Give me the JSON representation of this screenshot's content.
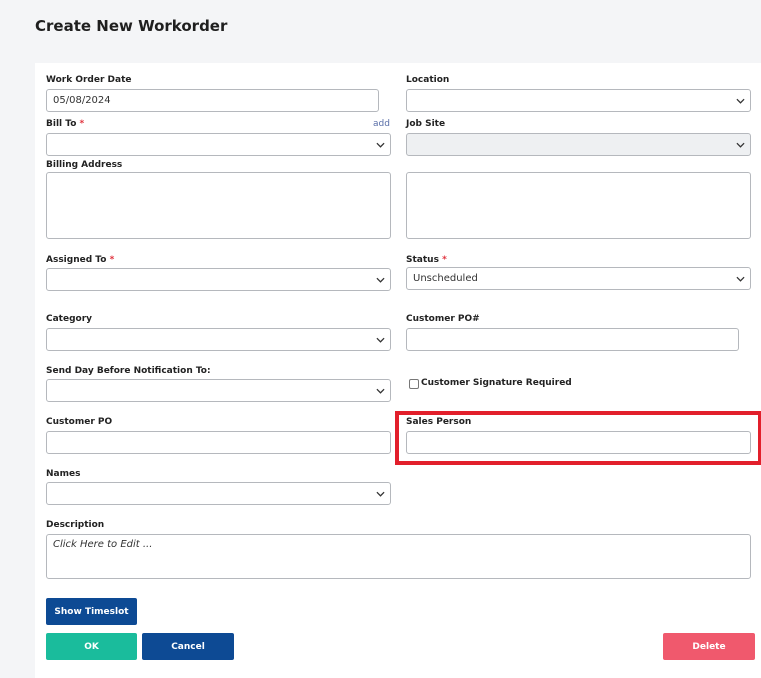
{
  "page_title": "Create New Workorder",
  "form": {
    "work_order_date": {
      "label": "Work Order Date",
      "value": "05/08/2024"
    },
    "location": {
      "label": "Location",
      "value": ""
    },
    "bill_to": {
      "label": "Bill To",
      "required_mark": "*",
      "add_link": "add",
      "value": ""
    },
    "job_site": {
      "label": "Job Site",
      "value": ""
    },
    "billing_address": {
      "label": "Billing Address",
      "value": ""
    },
    "assigned_to": {
      "label": "Assigned To",
      "required_mark": "*",
      "value": ""
    },
    "status": {
      "label": "Status",
      "required_mark": "*",
      "value": "Unscheduled"
    },
    "category": {
      "label": "Category",
      "value": ""
    },
    "customer_po_num": {
      "label": "Customer PO#",
      "value": ""
    },
    "send_day_before": {
      "label": "Send Day Before Notification To:",
      "value": ""
    },
    "customer_signature": {
      "label": "Customer Signature Required",
      "checked": false
    },
    "customer_po": {
      "label": "Customer PO",
      "value": ""
    },
    "sales_person": {
      "label": "Sales Person",
      "value": ""
    },
    "names": {
      "label": "Names",
      "value": ""
    },
    "description": {
      "label": "Description",
      "placeholder": "Click Here to Edit ..."
    }
  },
  "buttons": {
    "show_timeslot": "Show Timeslot",
    "ok": "OK",
    "cancel": "Cancel",
    "delete": "Delete"
  },
  "colors": {
    "primary": "#0d4a94",
    "ok": "#1abc9c",
    "delete": "#f0596d",
    "highlight": "#e21f2b",
    "required": "#e0323d"
  },
  "icons": {
    "dropdown": "chevron-down-icon"
  }
}
